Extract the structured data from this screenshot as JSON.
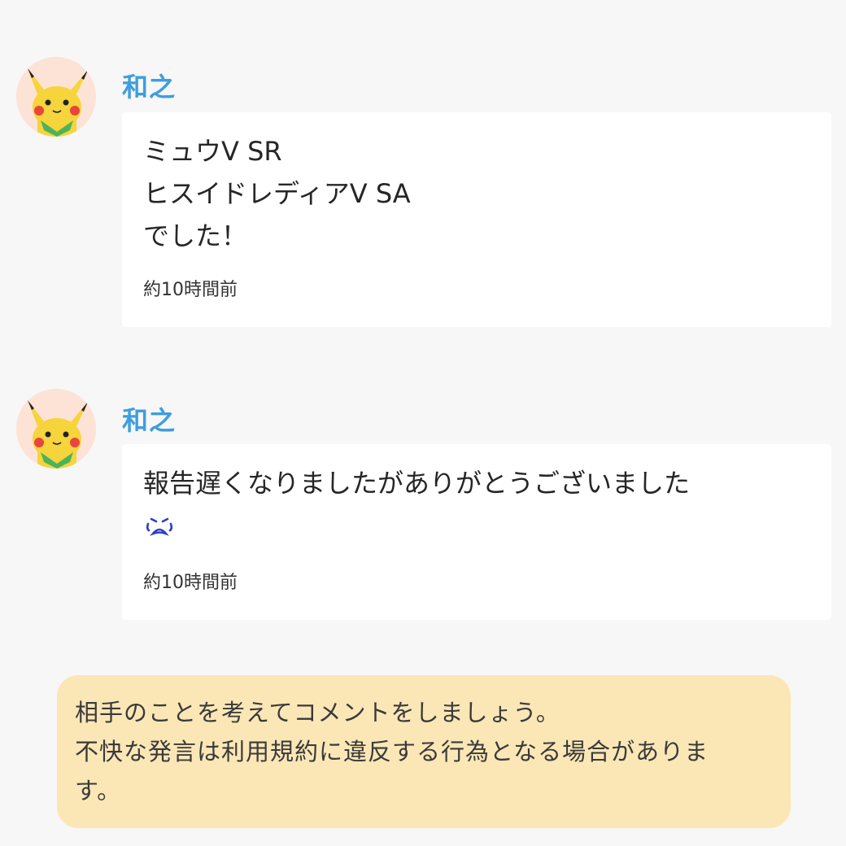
{
  "comments": [
    {
      "username": "和之",
      "lines": [
        "ミュウV SR",
        "ヒスイドレディアV SA",
        "でした！"
      ],
      "timestamp": "約10時間前",
      "avatar_icon": "pikachu-avatar-icon"
    },
    {
      "username": "和之",
      "lines": [
        "報告遅くなりましたがありがとうございました"
      ],
      "emoji_icon": "crying-face-icon",
      "timestamp": "約10時間前",
      "avatar_icon": "pikachu-avatar-icon"
    }
  ],
  "notice": {
    "lines": [
      "相手のことを考えてコメントをしましょう。",
      "不快な発言は利用規約に違反する行為となる場合がありま",
      "す。"
    ]
  },
  "colors": {
    "background": "#f7f7f7",
    "username": "#3e9ede",
    "notice_background": "#fbe7b6",
    "emoji": "#2a3fc9"
  }
}
